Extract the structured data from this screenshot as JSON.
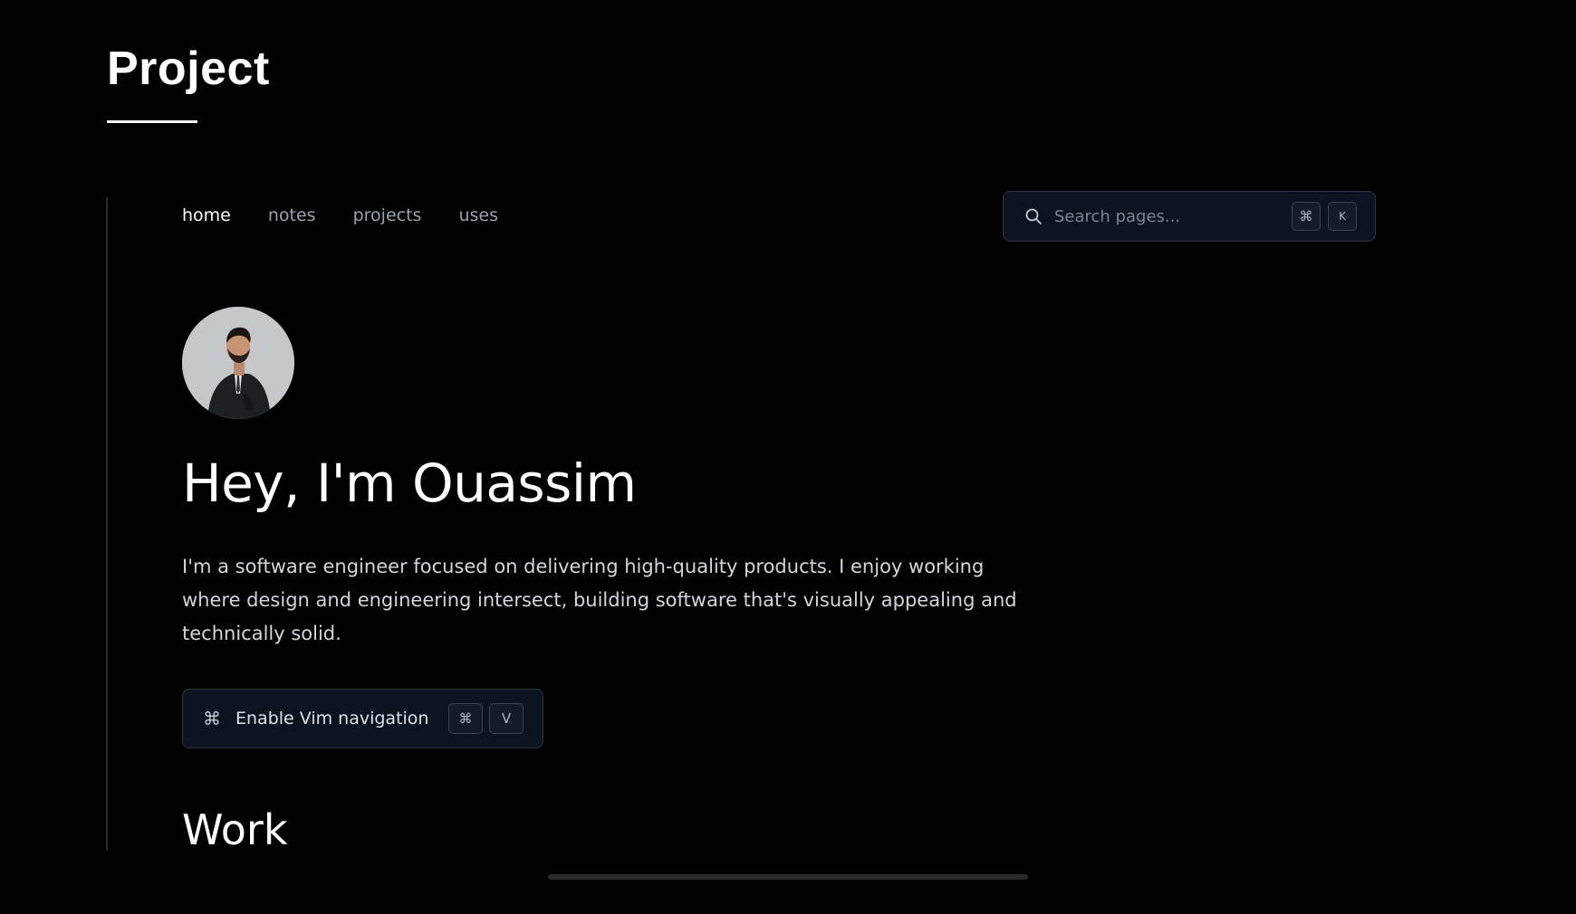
{
  "header": {
    "title": "Project"
  },
  "nav": {
    "items": [
      {
        "label": "home",
        "active": true
      },
      {
        "label": "notes",
        "active": false
      },
      {
        "label": "projects",
        "active": false
      },
      {
        "label": "uses",
        "active": false
      }
    ]
  },
  "search": {
    "placeholder": "Search pages...",
    "icon": "search-icon",
    "shortcut": [
      "⌘",
      "K"
    ]
  },
  "profile": {
    "avatar_icon": "avatar-photo",
    "greeting": "Hey, I'm Ouassim",
    "bio": "I'm a software engineer focused on delivering high-quality products. I enjoy working where design and engineering intersect, building software that's visually appealing and technically solid."
  },
  "vim": {
    "icon": "command-icon",
    "glyph": "⌘",
    "label": "Enable Vim navigation",
    "shortcut": [
      "⌘",
      "V"
    ]
  },
  "sections": {
    "work": "Work"
  },
  "colors": {
    "background": "#000000",
    "panel": "#0b1220",
    "border": "#2b3443",
    "text_muted": "#9aa3ad",
    "text_primary": "#ffffff"
  }
}
